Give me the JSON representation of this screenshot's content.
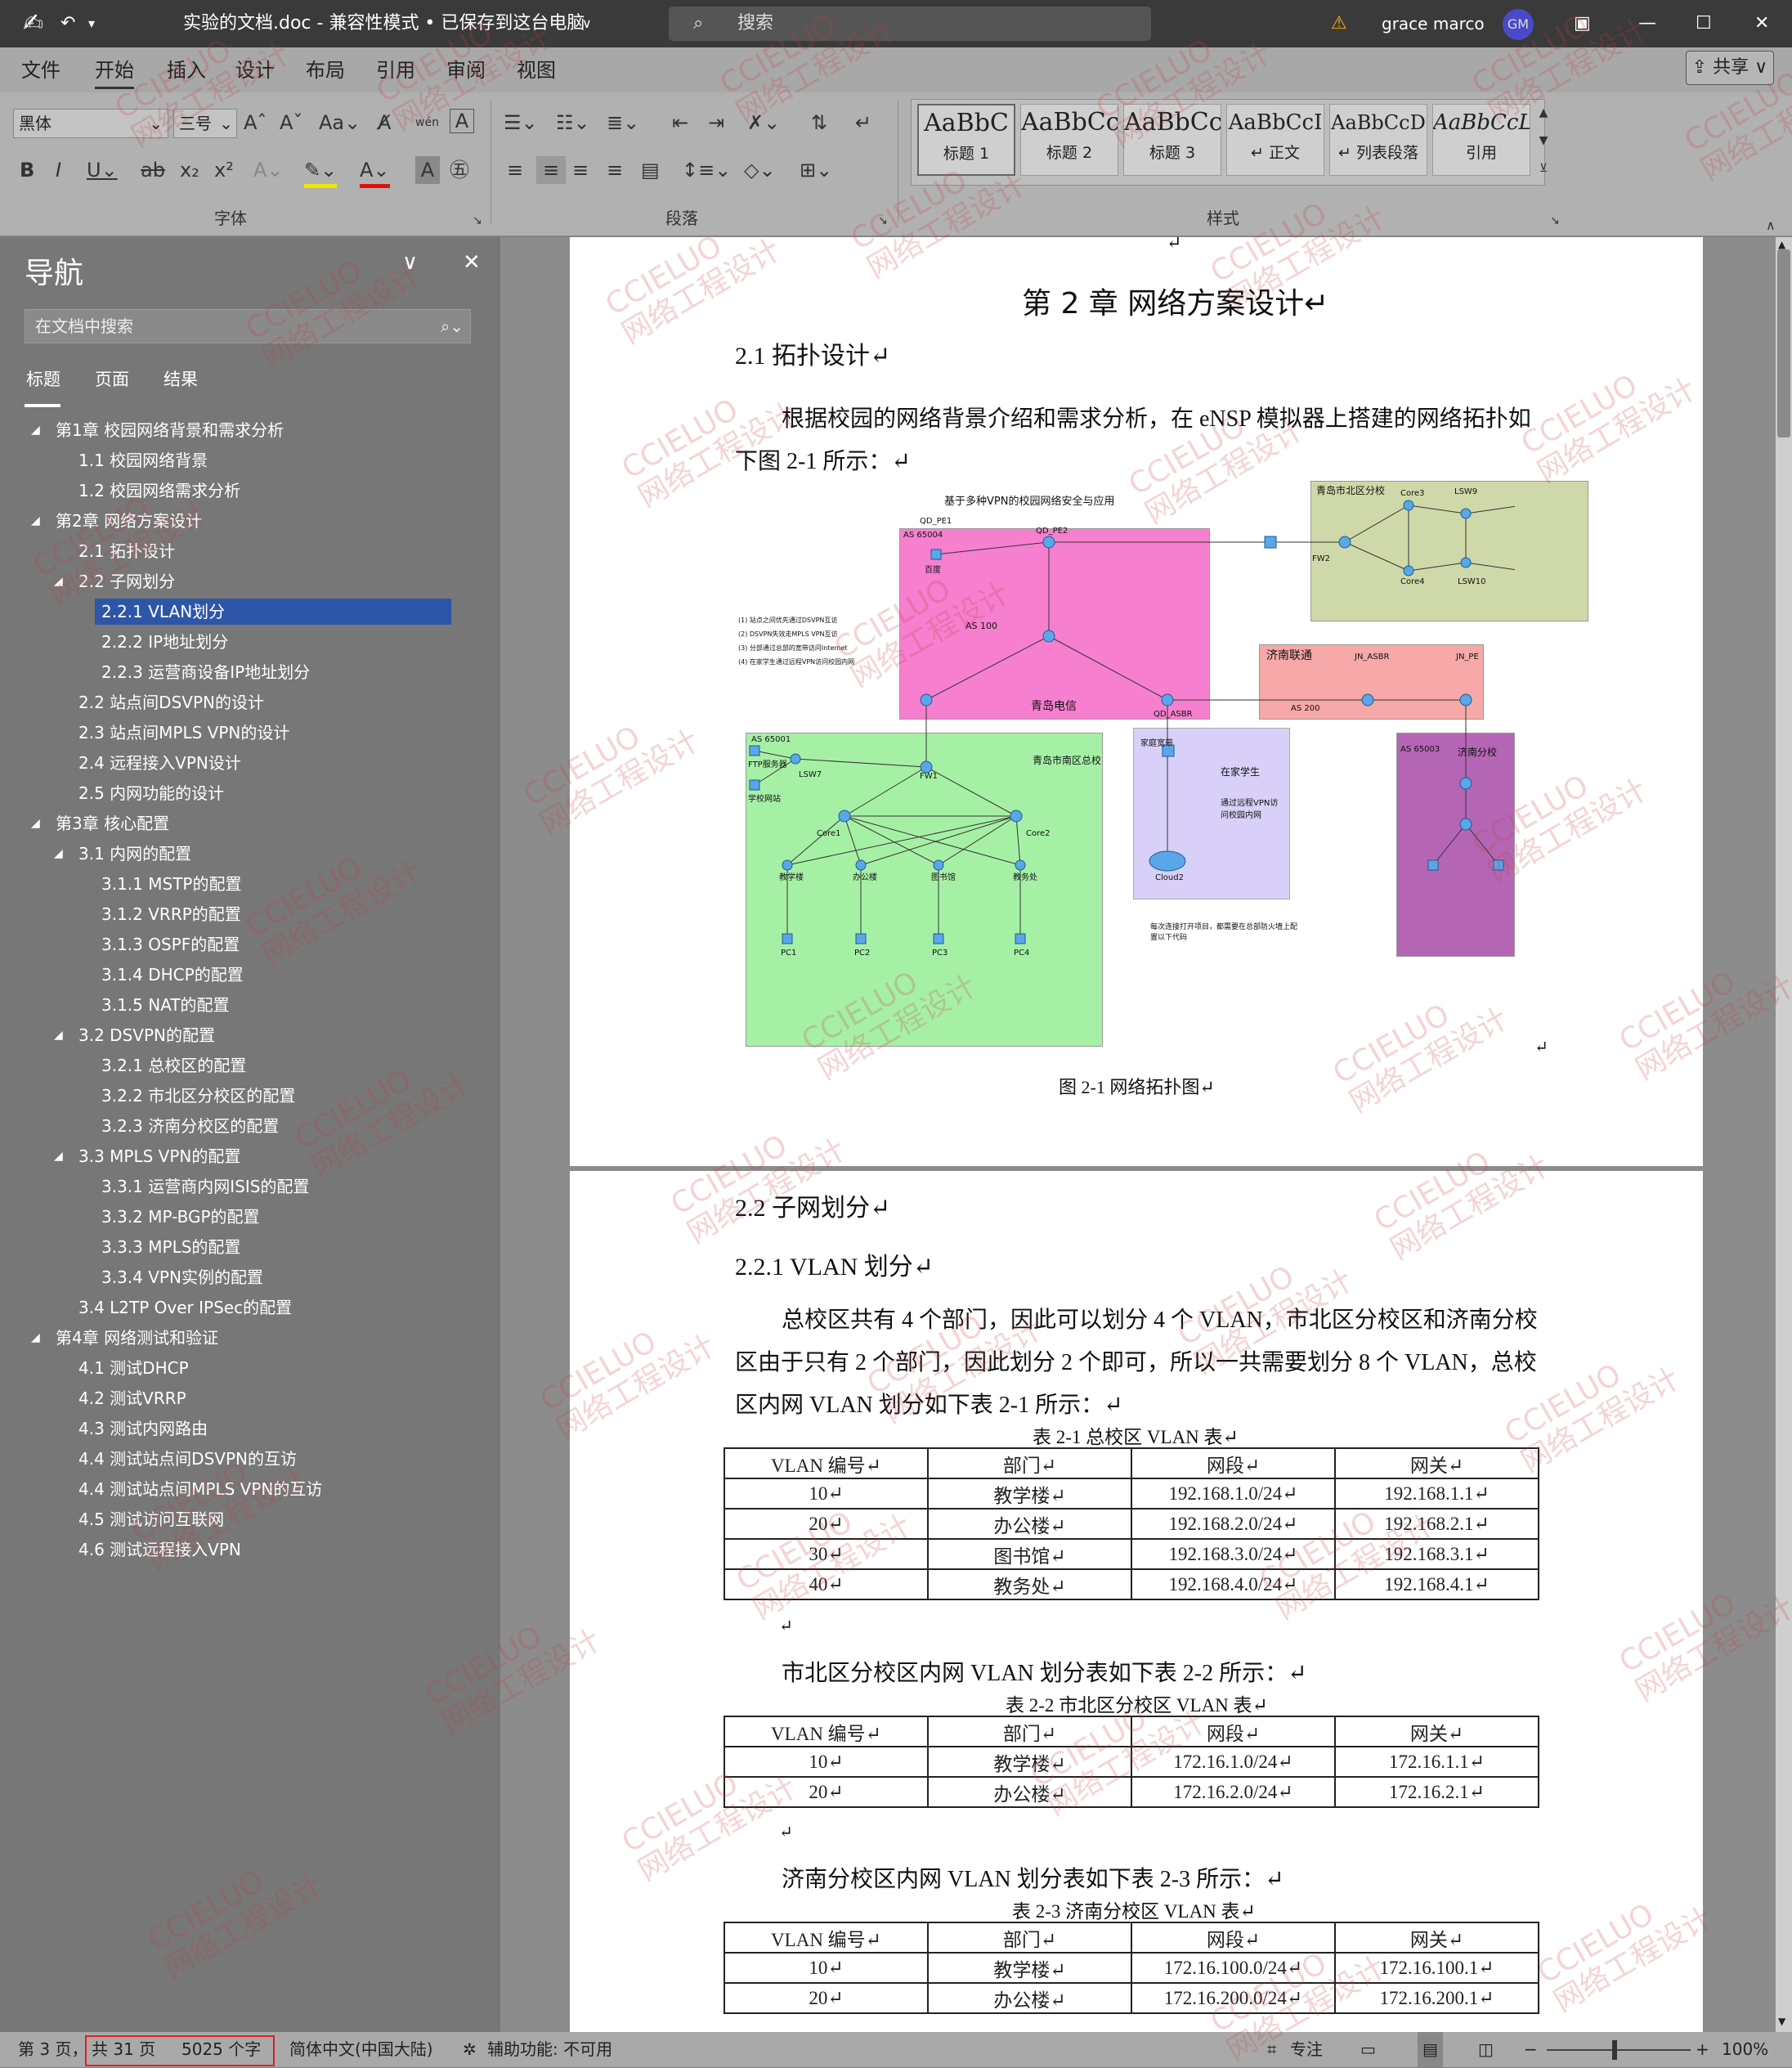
{
  "title_bar": {
    "doc_title": "实验的文档.doc  -  兼容性模式 • 已保存到这台电脑",
    "search_placeholder": "搜索",
    "user_name": "grace marco",
    "user_initials": "GM"
  },
  "menu": {
    "items": [
      "文件",
      "开始",
      "插入",
      "设计",
      "布局",
      "引用",
      "审阅",
      "视图"
    ],
    "share_label": "共享"
  },
  "ribbon": {
    "font_name": "黑体",
    "font_size": "三号",
    "group_font": "字体",
    "group_paragraph": "段落",
    "group_styles": "样式",
    "styles": [
      {
        "preview": "AaBbC",
        "name": "标题 1"
      },
      {
        "preview": "AaBbCc",
        "name": "标题 2"
      },
      {
        "preview": "AaBbCc",
        "name": "标题 3"
      },
      {
        "preview": "AaBbCcI",
        "name": "↵ 正文"
      },
      {
        "preview": "AaBbCcD",
        "name": "↵ 列表段落"
      },
      {
        "preview": "AaBbCcL",
        "name": "引用"
      }
    ]
  },
  "nav": {
    "title": "导航",
    "search_placeholder": "在文档中搜索",
    "tabs": [
      "标题",
      "页面",
      "结果"
    ],
    "items": [
      {
        "label": "第1章 校园网络背景和需求分析",
        "level": 1,
        "arrow": "◢"
      },
      {
        "label": "1.1 校园网络背景",
        "level": 2
      },
      {
        "label": "1.2 校园网络需求分析",
        "level": 2
      },
      {
        "label": "第2章 网络方案设计",
        "level": 1,
        "arrow": "◢"
      },
      {
        "label": "2.1 拓扑设计",
        "level": 2
      },
      {
        "label": "2.2 子网划分",
        "level": 2,
        "arrow": "◢"
      },
      {
        "label": "2.2.1 VLAN划分",
        "level": 3,
        "selected": true
      },
      {
        "label": "2.2.2 IP地址划分",
        "level": 3
      },
      {
        "label": "2.2.3 运营商设备IP地址划分",
        "level": 3
      },
      {
        "label": "2.2 站点间DSVPN的设计",
        "level": 2
      },
      {
        "label": "2.3 站点间MPLS VPN的设计",
        "level": 2
      },
      {
        "label": "2.4 远程接入VPN设计",
        "level": 2
      },
      {
        "label": "2.5 内网功能的设计",
        "level": 2
      },
      {
        "label": "第3章 核心配置",
        "level": 1,
        "arrow": "◢"
      },
      {
        "label": "3.1 内网的配置",
        "level": 2,
        "arrow": "◢"
      },
      {
        "label": "3.1.1 MSTP的配置",
        "level": 3
      },
      {
        "label": "3.1.2 VRRP的配置",
        "level": 3
      },
      {
        "label": "3.1.3 OSPF的配置",
        "level": 3
      },
      {
        "label": "3.1.4 DHCP的配置",
        "level": 3
      },
      {
        "label": "3.1.5 NAT的配置",
        "level": 3
      },
      {
        "label": "3.2 DSVPN的配置",
        "level": 2,
        "arrow": "◢"
      },
      {
        "label": "3.2.1 总校区的配置",
        "level": 3
      },
      {
        "label": "3.2.2 市北区分校区的配置",
        "level": 3
      },
      {
        "label": "3.2.3 济南分校区的配置",
        "level": 3
      },
      {
        "label": "3.3 MPLS VPN的配置",
        "level": 2,
        "arrow": "◢"
      },
      {
        "label": "3.3.1 运营商内网ISIS的配置",
        "level": 3
      },
      {
        "label": "3.3.2 MP-BGP的配置",
        "level": 3
      },
      {
        "label": "3.3.3 MPLS的配置",
        "level": 3
      },
      {
        "label": "3.3.4 VPN实例的配置",
        "level": 3
      },
      {
        "label": "3.4 L2TP Over IPSec的配置",
        "level": 2
      },
      {
        "label": "第4章 网络测试和验证",
        "level": 1,
        "arrow": "◢"
      },
      {
        "label": "4.1 测试DHCP",
        "level": 2
      },
      {
        "label": "4.2 测试VRRP",
        "level": 2
      },
      {
        "label": "4.3 测试内网路由",
        "level": 2
      },
      {
        "label": "4.4 测试站点间DSVPN的互访",
        "level": 2
      },
      {
        "label": "4.4 测试站点间MPLS VPN的互访",
        "level": 2
      },
      {
        "label": "4.5 测试访问互联网",
        "level": 2
      },
      {
        "label": "4.6 测试远程接入VPN",
        "level": 2
      }
    ]
  },
  "document": {
    "return_mark": "↵",
    "chapter_title": "第 2 章  网络方案设计↵",
    "h_2_1": "2.1  拓扑设计↵",
    "para_2_1_line1": "根据校园的网络背景介绍和需求分析，在 eNSP 模拟器上搭建的网络拓扑如",
    "para_2_1_line2": "下图 2-1 所示：↵",
    "figure_caption": "图 2-1  网络拓扑图↵",
    "h_2_2": "2.2  子网划分↵",
    "h_2_2_1": "2.2.1 VLAN 划分↵",
    "para_vlan_line1": "总校区共有 4 个部门，因此可以划分 4 个 VLAN，市北区分校区和济南分校",
    "para_vlan_line2": "区由于只有 2 个部门，因此划分 2 个即可，所以一共需要划分 8 个 VLAN，总校",
    "para_vlan_line3": "区内网 VLAN 划分如下表 2-1 所示：↵",
    "table1_caption": "表 2-1  总校区 VLAN 表↵",
    "table2_intro": "市北区分校区内网 VLAN 划分表如下表 2-2 所示：↵",
    "table2_caption": "表 2-2  市北区分校区 VLAN 表↵",
    "table3_intro": "济南分校区内网 VLAN 划分表如下表 2-3 所示：↵",
    "table3_caption": "表 2-3  济南分校区 VLAN 表↵",
    "table_headers": [
      "VLAN 编号↵",
      "部门↵",
      "网段↵",
      "网关↵"
    ],
    "table1_rows": [
      [
        "10↵",
        "教学楼↵",
        "192.168.1.0/24↵",
        "192.168.1.1↵"
      ],
      [
        "20↵",
        "办公楼↵",
        "192.168.2.0/24↵",
        "192.168.2.1↵"
      ],
      [
        "30↵",
        "图书馆↵",
        "192.168.3.0/24↵",
        "192.168.3.1↵"
      ],
      [
        "40↵",
        "教务处↵",
        "192.168.4.0/24↵",
        "192.168.4.1↵"
      ]
    ],
    "table2_rows": [
      [
        "10↵",
        "教学楼↵",
        "172.16.1.0/24↵",
        "172.16.1.1↵"
      ],
      [
        "20↵",
        "办公楼↵",
        "172.16.2.0/24↵",
        "172.16.2.1↵"
      ]
    ],
    "table3_rows": [
      [
        "10↵",
        "教学楼↵",
        "172.16.100.0/24↵",
        "172.16.100.1↵"
      ],
      [
        "20↵",
        "办公楼↵",
        "172.16.200.0/24↵",
        "172.16.200.1↵"
      ]
    ]
  },
  "topology": {
    "title": "基于多种VPN的校园网络安全与应用",
    "areas": {
      "telecom": "青岛电信",
      "unicom": "济南联通",
      "main": "青岛市南区总校",
      "north": "青岛市北区分校",
      "jinan": "济南分校",
      "home": "在家学生"
    },
    "as": [
      "AS 100",
      "AS 200",
      "AS 65004",
      "AS 65001",
      "AS 65003"
    ],
    "devices": [
      "QD_PE1",
      "QD_PE2",
      "QD_ASBR",
      "JN_ASBR",
      "JN_PE",
      "FW1",
      "FW2",
      "Core1",
      "Core2",
      "Core3",
      "Core4",
      "LSW7",
      "LSW9",
      "LSW10",
      "PC1",
      "PC2",
      "PC3",
      "PC4",
      "百度",
      "Cloud2",
      "家庭宽带",
      "教学楼",
      "办公楼",
      "图书馆",
      "教务处",
      "FTP服务器",
      "学校网站"
    ],
    "notes": [
      "(1) 站点之间优先通过DSVPN互访",
      "(2) DSVPN失效走MPLS VPN互访",
      "(3) 分部通过总部的宽带访问Internet",
      "(4) 在家学生通过远程VPN访问校园内网"
    ],
    "remote_note": "通过远程VPN访问校园内网",
    "fw_note": "每次连接打开项目，都需要在总部防火墙上配置以下代码"
  },
  "status_bar": {
    "page": "第 3 页，",
    "total_pages": "共 31 页",
    "word_count": "5025 个字",
    "language": "简体中文(中国大陆)",
    "accessibility": "辅助功能: 不可用",
    "focus": "专注",
    "zoom": "100%"
  },
  "watermark": {
    "line1": "CCIELUO",
    "line2": "网络工程设计"
  },
  "colors": {
    "title_bar": "#3a3a3a",
    "nav_selected": "#2e56a8",
    "telecom_area": "#f67fcf",
    "main_campus_area": "#a6f0a6",
    "north_campus_area": "#cfd8a8",
    "jinan_area": "#b466b4",
    "unicom_area": "#f7a8a8",
    "home_area": "#d8d0f8"
  }
}
